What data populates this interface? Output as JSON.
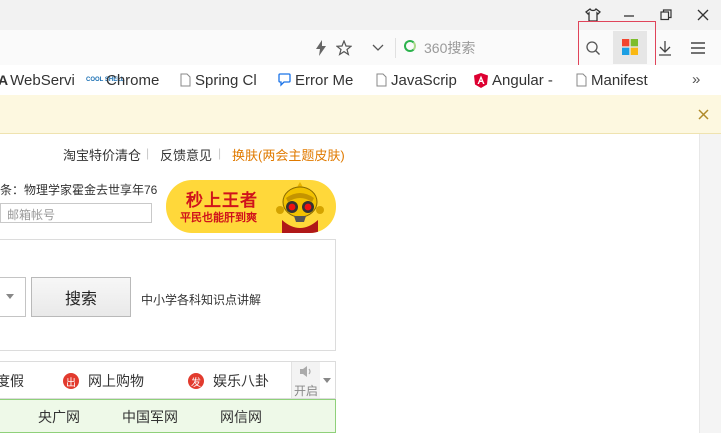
{
  "window": {
    "skin_icon": "shirt-icon",
    "minimize_icon": "minimize-icon",
    "restore_icon": "restore-icon",
    "close_icon": "close-icon"
  },
  "toolbar": {
    "search_placeholder": "360搜索",
    "icons": [
      "lightning-icon",
      "star-icon",
      "chevron-down-icon",
      "search-icon",
      "apps-grid-icon",
      "download-icon",
      "menu-icon"
    ]
  },
  "bookmarks": {
    "items": [
      {
        "label": "WebServi",
        "icon": "a-icon"
      },
      {
        "label": "Chrome",
        "icon": "coolshell-icon",
        "icon_text": "COOL SHELL"
      },
      {
        "label": "Spring Cl",
        "icon": "page-icon"
      },
      {
        "label": "Error Me",
        "icon": "chat-icon"
      },
      {
        "label": "JavaScrip",
        "icon": "page-icon"
      },
      {
        "label": "Angular -",
        "icon": "angular-icon"
      },
      {
        "label": "Manifest",
        "icon": "page-icon"
      }
    ],
    "more": "»"
  },
  "page": {
    "top_links": [
      "淘宝特价清仓",
      "反馈意见",
      "换肤(两会主题皮肤)"
    ],
    "top_sep": "|",
    "accent_color": "#e07a00",
    "news": "条：物理学家霍金去世享年76",
    "email_placeholder": "邮箱帐号",
    "ad": {
      "title": "秒上王者",
      "subtitle": "平民也能肝到爽"
    },
    "search_button": "搜索",
    "search_hint": "中小学各科知识点讲解",
    "nav": [
      {
        "label": "度假"
      },
      {
        "label": "网上购物",
        "badge": "出"
      },
      {
        "label": "娱乐八卦",
        "badge": "发"
      }
    ],
    "sound_label": "开启",
    "site_links": [
      "央广网",
      "中国军网",
      "网信网"
    ]
  }
}
